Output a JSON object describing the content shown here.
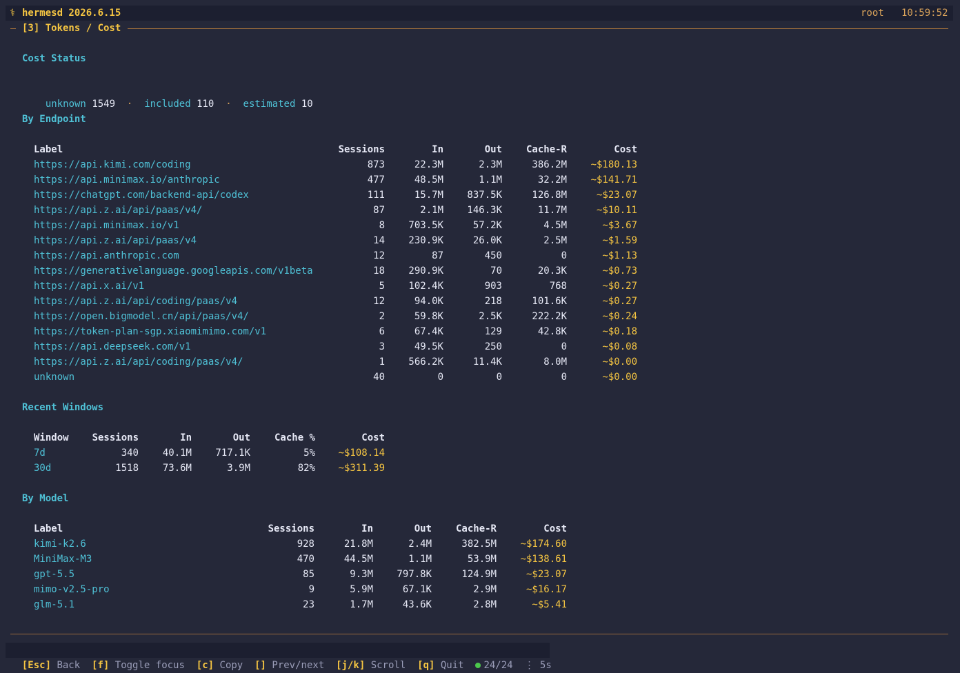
{
  "header": {
    "icon": "⚕",
    "app": "hermesd 2026.6.15",
    "user": "root",
    "time": "10:59:52"
  },
  "panel": {
    "title": "[3] Tokens / Cost"
  },
  "cost_status": {
    "title": "Cost Status",
    "items": [
      {
        "label": "unknown",
        "value": "1549"
      },
      {
        "label": "included",
        "value": "110"
      },
      {
        "label": "estimated",
        "value": "10"
      }
    ],
    "separator": "·"
  },
  "by_endpoint": {
    "title": "By Endpoint",
    "columns": [
      "Label",
      "Sessions",
      "In",
      "Out",
      "Cache-R",
      "Cost"
    ],
    "rows": [
      [
        "https://api.kimi.com/coding",
        "873",
        "22.3M",
        "2.3M",
        "386.2M",
        "~$180.13"
      ],
      [
        "https://api.minimax.io/anthropic",
        "477",
        "48.5M",
        "1.1M",
        "32.2M",
        "~$141.71"
      ],
      [
        "https://chatgpt.com/backend-api/codex",
        "111",
        "15.7M",
        "837.5K",
        "126.8M",
        "~$23.07"
      ],
      [
        "https://api.z.ai/api/paas/v4/",
        "87",
        "2.1M",
        "146.3K",
        "11.7M",
        "~$10.11"
      ],
      [
        "https://api.minimax.io/v1",
        "8",
        "703.5K",
        "57.2K",
        "4.5M",
        "~$3.67"
      ],
      [
        "https://api.z.ai/api/paas/v4",
        "14",
        "230.9K",
        "26.0K",
        "2.5M",
        "~$1.59"
      ],
      [
        "https://api.anthropic.com",
        "12",
        "87",
        "450",
        "0",
        "~$1.13"
      ],
      [
        "https://generativelanguage.googleapis.com/v1beta",
        "18",
        "290.9K",
        "70",
        "20.3K",
        "~$0.73"
      ],
      [
        "https://api.x.ai/v1",
        "5",
        "102.4K",
        "903",
        "768",
        "~$0.27"
      ],
      [
        "https://api.z.ai/api/coding/paas/v4",
        "12",
        "94.0K",
        "218",
        "101.6K",
        "~$0.27"
      ],
      [
        "https://open.bigmodel.cn/api/paas/v4/",
        "2",
        "59.8K",
        "2.5K",
        "222.2K",
        "~$0.24"
      ],
      [
        "https://token-plan-sgp.xiaomimimo.com/v1",
        "6",
        "67.4K",
        "129",
        "42.8K",
        "~$0.18"
      ],
      [
        "https://api.deepseek.com/v1",
        "3",
        "49.5K",
        "250",
        "0",
        "~$0.08"
      ],
      [
        "https://api.z.ai/api/coding/paas/v4/",
        "1",
        "566.2K",
        "11.4K",
        "8.0M",
        "~$0.00"
      ],
      [
        "unknown",
        "40",
        "0",
        "0",
        "0",
        "~$0.00"
      ]
    ]
  },
  "recent_windows": {
    "title": "Recent Windows",
    "columns": [
      "Window",
      "Sessions",
      "In",
      "Out",
      "Cache %",
      "Cost"
    ],
    "rows": [
      [
        "7d",
        "340",
        "40.1M",
        "717.1K",
        "5%",
        "~$108.14"
      ],
      [
        "30d",
        "1518",
        "73.6M",
        "3.9M",
        "82%",
        "~$311.39"
      ]
    ]
  },
  "by_model": {
    "title": "By Model",
    "columns": [
      "Label",
      "Sessions",
      "In",
      "Out",
      "Cache-R",
      "Cost"
    ],
    "rows": [
      [
        "kimi-k2.6",
        "928",
        "21.8M",
        "2.4M",
        "382.5M",
        "~$174.60"
      ],
      [
        "MiniMax-M3",
        "470",
        "44.5M",
        "1.1M",
        "53.9M",
        "~$138.61"
      ],
      [
        "gpt-5.5",
        "85",
        "9.3M",
        "797.8K",
        "124.9M",
        "~$23.07"
      ],
      [
        "mimo-v2.5-pro",
        "9",
        "5.9M",
        "67.1K",
        "2.9M",
        "~$16.17"
      ],
      [
        "glm-5.1",
        "23",
        "1.7M",
        "43.6K",
        "2.8M",
        "~$5.41"
      ]
    ]
  },
  "footer": {
    "keys": [
      {
        "key": "[Esc]",
        "label": "Back"
      },
      {
        "key": "[f]",
        "label": "Toggle focus"
      },
      {
        "key": "[c]",
        "label": "Copy"
      },
      {
        "key": "[]",
        "label": "Prev/next"
      },
      {
        "key": "[j/k]",
        "label": "Scroll"
      },
      {
        "key": "[q]",
        "label": "Quit"
      }
    ],
    "status": "24/24",
    "interval_icon": "⋮",
    "interval": "5s"
  },
  "colors": {
    "background": "#252839",
    "accent_yellow": "#f5c542",
    "accent_cyan": "#4fc1d6",
    "rule": "#9a6b3c",
    "ok_green": "#4cc94c"
  }
}
